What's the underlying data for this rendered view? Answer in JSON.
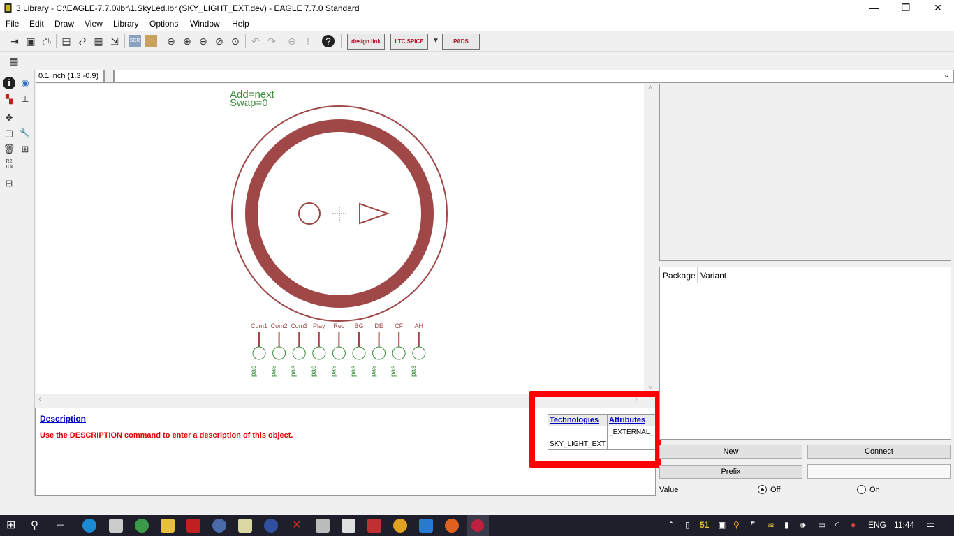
{
  "window": {
    "title": "3 Library - C:\\EAGLE-7.7.0\\lbr\\1.SkyLed.lbr (SKY_LIGHT_EXT.dev) - EAGLE 7.7.0 Standard",
    "minimize": "—",
    "restore": "❐",
    "close": "✕"
  },
  "menu": [
    "File",
    "Edit",
    "Draw",
    "View",
    "Library",
    "Options",
    "Window",
    "Help"
  ],
  "toolbar": {
    "designlink_label": "design link",
    "ltspice_label": "LTC SPICE",
    "pads_label": "PADS"
  },
  "coords": {
    "readout": "0.1 inch (1.3 -0.9)",
    "command_value": ""
  },
  "symbol": {
    "add_text": "Add=next",
    "swap_text": "Swap=0",
    "pins": [
      {
        "name": "Com1",
        "dir": "pas"
      },
      {
        "name": "Com2",
        "dir": "pas"
      },
      {
        "name": "Com3",
        "dir": "pas"
      },
      {
        "name": "Play",
        "dir": "pas"
      },
      {
        "name": "Rec",
        "dir": "pas"
      },
      {
        "name": "BG",
        "dir": "pas"
      },
      {
        "name": "DE",
        "dir": "pas"
      },
      {
        "name": "CF",
        "dir": "pas"
      },
      {
        "name": "AH",
        "dir": "pas"
      }
    ]
  },
  "description": {
    "link": "Description",
    "text": "Use the DESCRIPTION command to enter a description of this object."
  },
  "tech_table": {
    "headers": [
      "Technologies",
      "Attributes"
    ],
    "rows": [
      [
        "",
        "_EXTERNAL_"
      ],
      [
        "SKY_LIGHT_EXT",
        ""
      ]
    ]
  },
  "package_panel": {
    "col_package": "Package",
    "col_variant": "Variant"
  },
  "buttons": {
    "new": "New",
    "connect": "Connect",
    "prefix": "Prefix"
  },
  "value": {
    "label": "Value",
    "off": "Off",
    "on": "On",
    "selected": "Off"
  },
  "tray": {
    "badge": "51",
    "lang": "ENG",
    "time": "11:44"
  },
  "colors": {
    "symbol": "#a04848",
    "text_green": "#3c8c3c",
    "highlight": "#ff0000",
    "link": "#0000c0"
  }
}
